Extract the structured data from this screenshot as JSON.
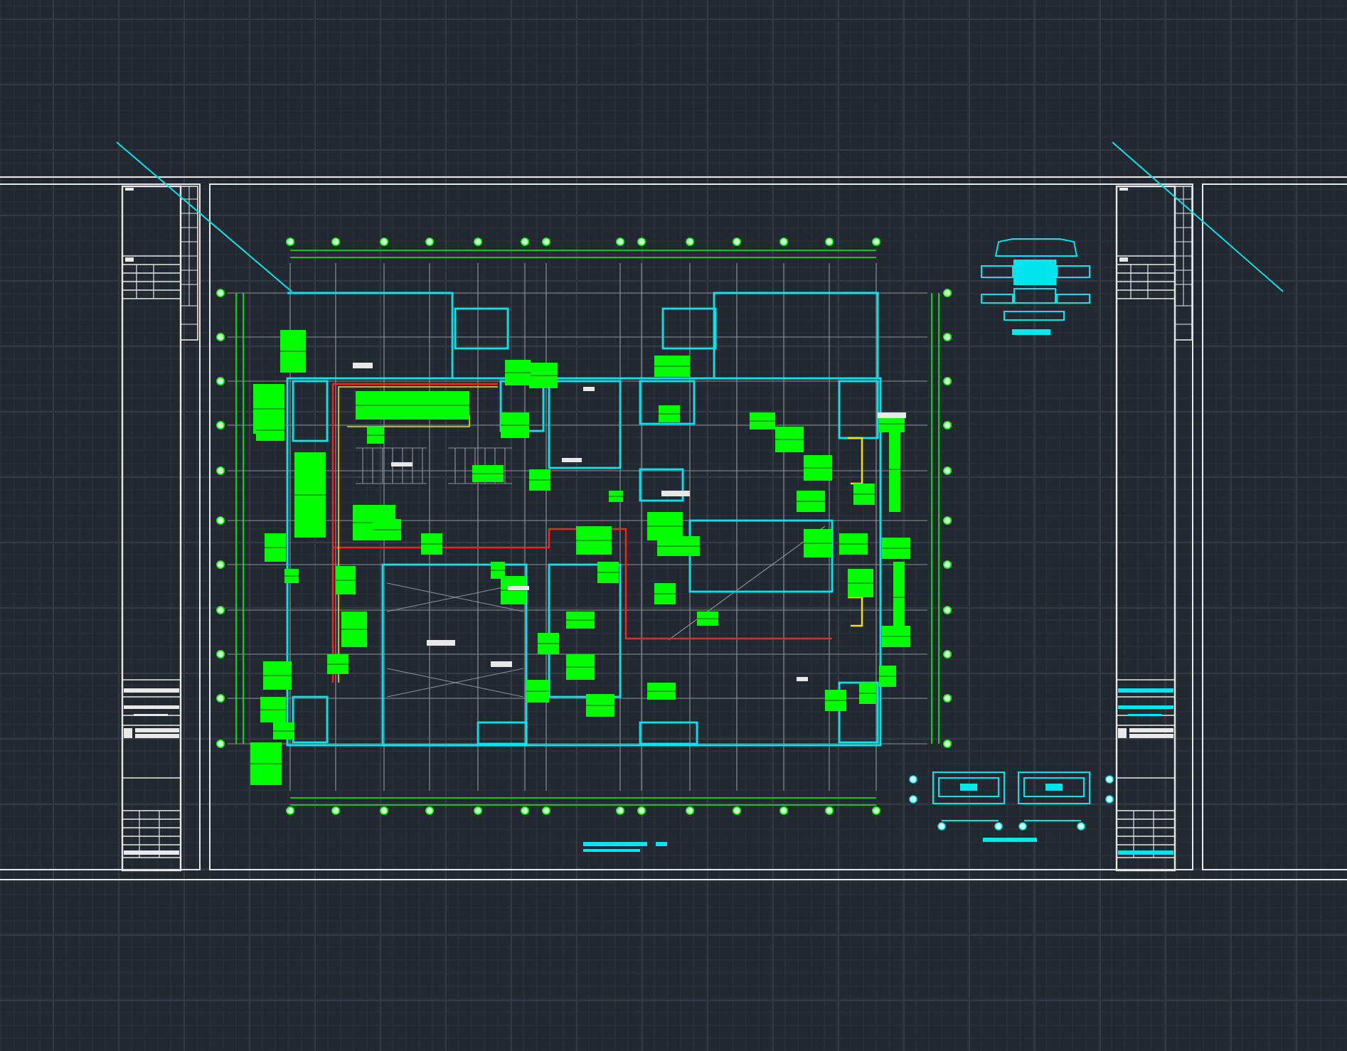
{
  "sheets": [
    {
      "kind": "title-block"
    },
    {
      "kind": "floor-plan"
    },
    {
      "kind": "empty"
    }
  ]
}
